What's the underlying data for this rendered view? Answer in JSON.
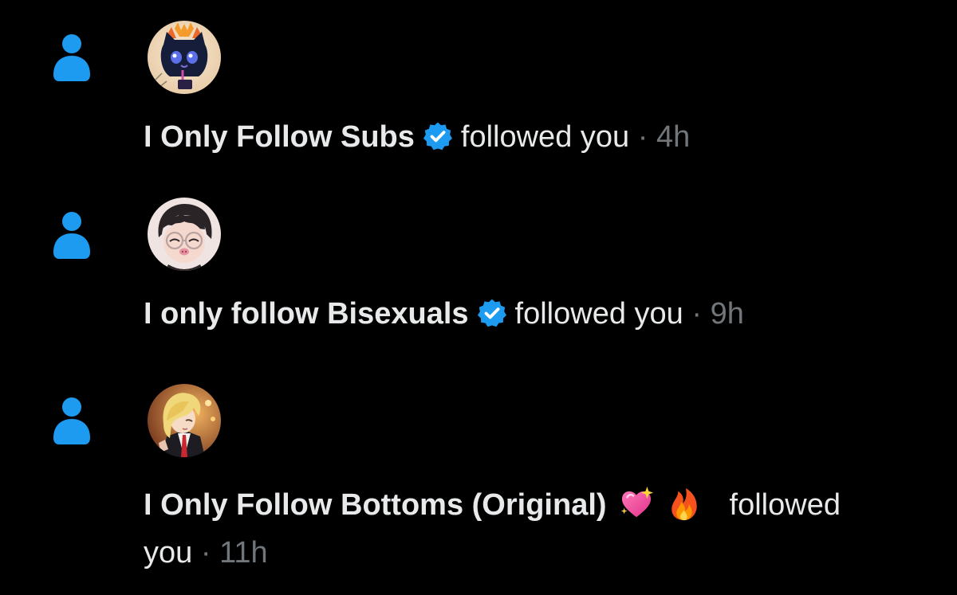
{
  "theme": {
    "accent": "#1d9bf0",
    "text": "#e7e9ea",
    "muted": "#71767b",
    "background": "#000000"
  },
  "notifications": [
    {
      "type_icon": "person-icon",
      "avatar": "cat-avatar",
      "name": "I Only Follow Subs",
      "verified": true,
      "action": "followed you",
      "separator": "·",
      "time": "4h"
    },
    {
      "type_icon": "person-icon",
      "avatar": "glasses-character-avatar",
      "name": "I only follow Bisexuals",
      "verified": true,
      "action": "followed you",
      "separator": "·",
      "time": "9h"
    },
    {
      "type_icon": "person-icon",
      "avatar": "blonde-character-avatar",
      "name": "I Only Follow Bottoms (Original)",
      "emojis": [
        "sparkling-heart-emoji",
        "fire-emoji"
      ],
      "action_part1": "followed",
      "action_part2": "you",
      "separator": "·",
      "time": "11h"
    }
  ]
}
